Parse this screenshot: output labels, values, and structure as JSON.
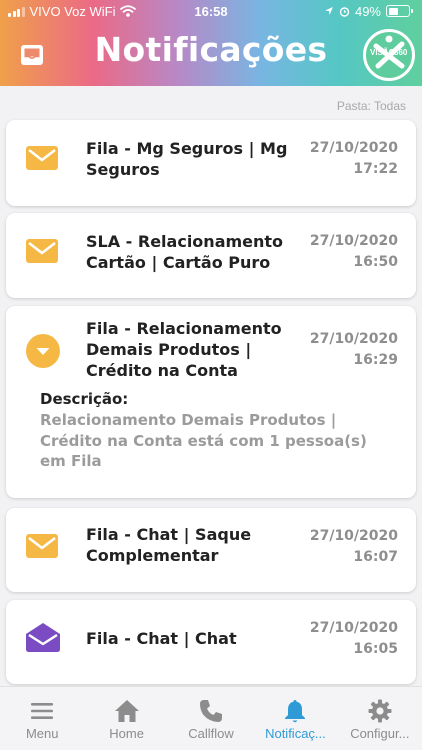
{
  "status_bar": {
    "carrier": "VIVO Voz WiFi",
    "time": "16:58",
    "battery": "49%",
    "battery_level": 0.49
  },
  "header": {
    "title": "Notificações",
    "logo_text_left": "VISÃO",
    "logo_text_right": "360"
  },
  "folder_label": "Pasta: Todas",
  "notifications": [
    {
      "title": "Fila - Mg Seguros | Mg Seguros",
      "date": "27/10/2020",
      "time": "17:22",
      "icon": "mail-icon"
    },
    {
      "title": "SLA - Relacionamento Cartão | Cartão Puro",
      "date": "27/10/2020",
      "time": "16:50",
      "icon": "mail-icon"
    },
    {
      "title": "Fila - Relacionamento Demais Produtos | Crédito na Conta",
      "date": "27/10/2020",
      "time": "16:29",
      "icon": "chevron-down-icon",
      "description_label": "Descrição:",
      "description": "Relacionamento Demais Produtos | Crédito na Conta está com 1 pessoa(s) em Fila"
    },
    {
      "title": "Fila - Chat | Saque Complementar",
      "date": "27/10/2020",
      "time": "16:07",
      "icon": "mail-icon"
    },
    {
      "title": "Fila - Chat | Chat",
      "date": "27/10/2020",
      "time": "16:05",
      "icon": "mail-open-icon"
    }
  ],
  "tabs": [
    {
      "label": "Menu",
      "icon": "menu-icon"
    },
    {
      "label": "Home",
      "icon": "home-icon"
    },
    {
      "label": "Callflow",
      "icon": "phone-icon"
    },
    {
      "label": "Notificaç...",
      "icon": "bell-icon",
      "active": true
    },
    {
      "label": "Configur...",
      "icon": "gear-icon"
    }
  ],
  "colors": {
    "mail": "#f5b845",
    "mail_open": "#7b4bc4",
    "active_tab": "#2e9bd6",
    "logo_bg": "#5fcc9d"
  }
}
